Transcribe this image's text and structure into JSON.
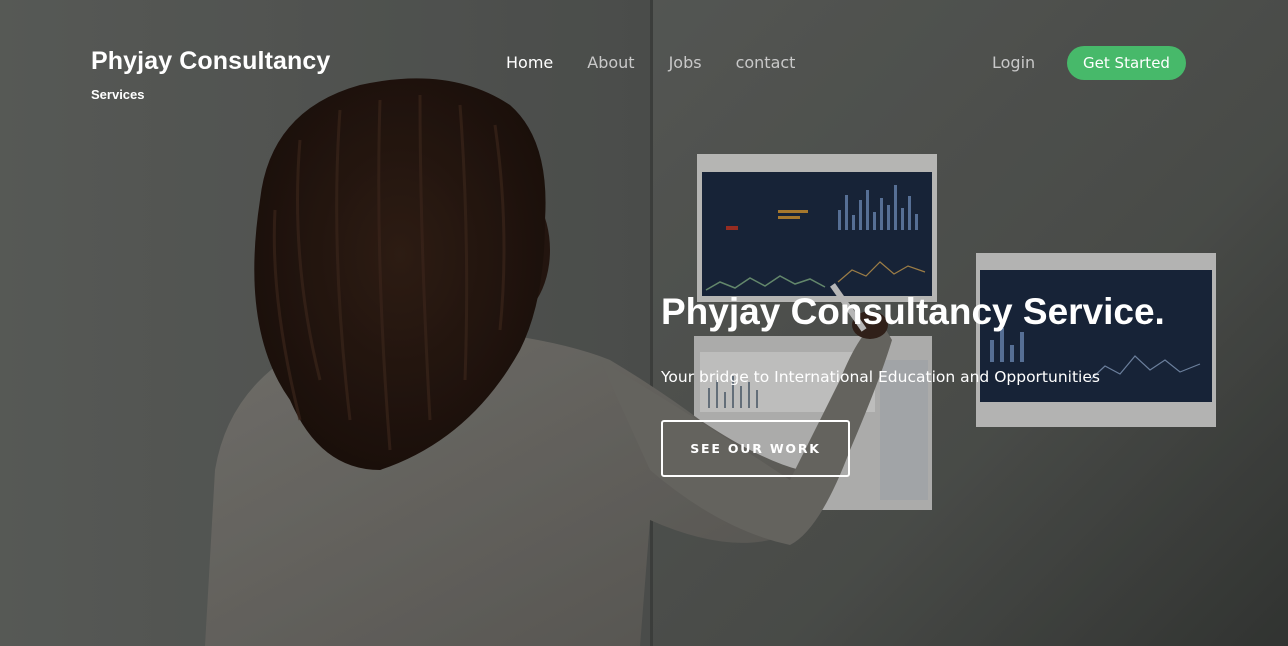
{
  "header": {
    "brand_title": "Phyjay Consultancy",
    "brand_subtitle": "Services",
    "nav": [
      {
        "label": "Home",
        "active": true
      },
      {
        "label": "About",
        "active": false
      },
      {
        "label": "Jobs",
        "active": false
      },
      {
        "label": "contact",
        "active": false
      }
    ],
    "login_label": "Login",
    "cta_label": "Get Started"
  },
  "hero": {
    "title": "Phyjay Consultancy Service.",
    "subtitle": "Your bridge to International Education and Opportunities",
    "button_label": "SEE OUR WORK",
    "background_image": "woman-pointing-at-charts-photo"
  },
  "colors": {
    "accent_green": "#47b96a",
    "overlay": "#000000",
    "text_primary": "#ffffff",
    "nav_inactive": "#c9c9c9"
  }
}
